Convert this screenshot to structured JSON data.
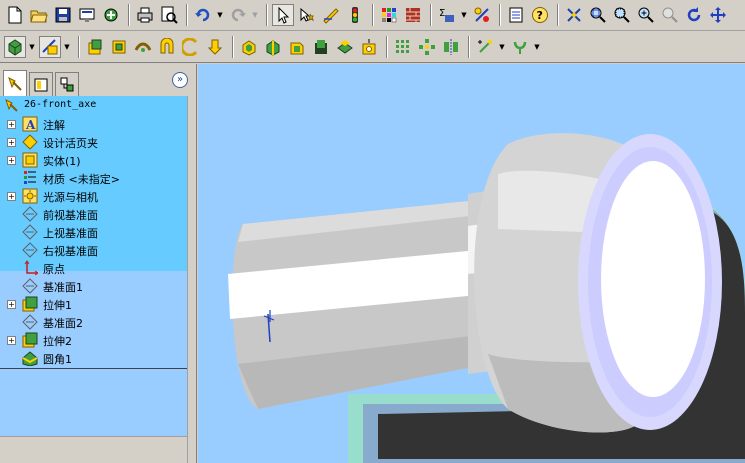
{
  "toolbar1": {
    "buttons": [
      "new-icon",
      "open-icon",
      "save-icon",
      "print-preview-icon",
      "options-icon",
      "printer-icon",
      "preview-icon",
      "undo-icon",
      "redo-icon",
      "select-icon",
      "smart-select-icon",
      "sketch-icon",
      "rebuild-icon",
      "palette-icon",
      "texture-icon",
      "measure-icon",
      "mass-properties-icon",
      "properties-icon",
      "help-icon",
      "rotate-view-icon",
      "zoom-fit-icon",
      "zoom-area-icon",
      "zoom-in-icon",
      "zoom-out-icon",
      "refresh-icon",
      "pan-icon"
    ]
  },
  "toolbar2": {
    "buttons": [
      "display-style-icon",
      "section-view-icon",
      "extrude-boss-icon",
      "revolve-boss-icon",
      "sweep-icon",
      "loft-icon",
      "fillet-icon",
      "chamfer-icon",
      "extrude-cut-icon",
      "revolve-cut-icon",
      "shell-icon",
      "rib-icon",
      "draft-icon",
      "hole-icon",
      "linear-pattern-icon",
      "circular-pattern-icon",
      "mirror-icon",
      "reference-point-icon",
      "curve-icon"
    ]
  },
  "panel": {
    "tabs": [
      "feature-manager",
      "property-manager",
      "configuration-manager"
    ],
    "collapse_label": "»"
  },
  "tree": {
    "root": "26-front_axe",
    "items": [
      {
        "label": "注解",
        "icon": "annotations-icon",
        "expandable": true
      },
      {
        "label": "设计活页夹",
        "icon": "design-binder-icon",
        "expandable": true
      },
      {
        "label": "实体(1)",
        "icon": "solid-bodies-icon",
        "expandable": true
      },
      {
        "label": "材质 <未指定>",
        "icon": "material-icon",
        "expandable": false
      },
      {
        "label": "光源与相机",
        "icon": "lights-cameras-icon",
        "expandable": true
      },
      {
        "label": "前视基准面",
        "icon": "plane-icon",
        "expandable": false
      },
      {
        "label": "上视基准面",
        "icon": "plane-icon",
        "expandable": false
      },
      {
        "label": "右视基准面",
        "icon": "plane-icon",
        "expandable": false
      },
      {
        "label": "原点",
        "icon": "origin-icon",
        "expandable": false
      },
      {
        "label": "基准面1",
        "icon": "plane-icon",
        "expandable": false
      },
      {
        "label": "拉伸1",
        "icon": "extrude-icon",
        "expandable": true
      },
      {
        "label": "基准面2",
        "icon": "plane-icon",
        "expandable": false
      },
      {
        "label": "拉伸2",
        "icon": "extrude-icon",
        "expandable": true
      },
      {
        "label": "圆角1",
        "icon": "fillet-feature-icon",
        "expandable": false
      }
    ]
  },
  "colors": {
    "tree_bg": "#66ccff",
    "tree_lower_bg": "#99ccff",
    "viewport_bg": "#99ccff",
    "part_light": "#c8c8c8",
    "part_highlight": "#ffffff",
    "part_edge": "#ccccff",
    "shadow": "#333333"
  }
}
